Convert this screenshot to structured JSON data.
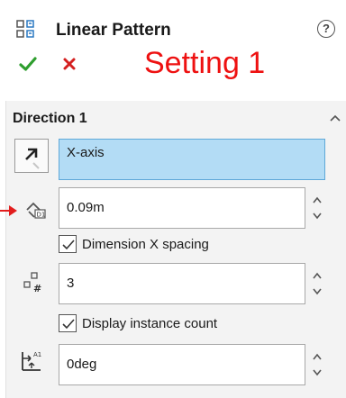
{
  "header": {
    "title": "Linear Pattern",
    "help_label": "?",
    "setting_label": "Setting 1"
  },
  "section": {
    "title": "Direction 1",
    "direction_value": "X-axis",
    "spacing_value": "0.09m",
    "dimension_spacing_label": "Dimension X spacing",
    "dimension_spacing_checked": true,
    "instance_value": "3",
    "display_count_label": "Display instance count",
    "display_count_checked": true,
    "angle_value": "0deg"
  },
  "colors": {
    "ok_green": "#2e9e2e",
    "cancel_red": "#d42020",
    "annotation_red": "#ee1111",
    "selected_field": "#b3dcf5"
  },
  "icons": [
    "linear-pattern-icon",
    "help-icon",
    "checkmark-icon",
    "close-icon",
    "chevron-up-icon",
    "reverse-direction-icon",
    "spacing-icon",
    "instance-count-icon",
    "angle-icon",
    "spinner-icon"
  ]
}
